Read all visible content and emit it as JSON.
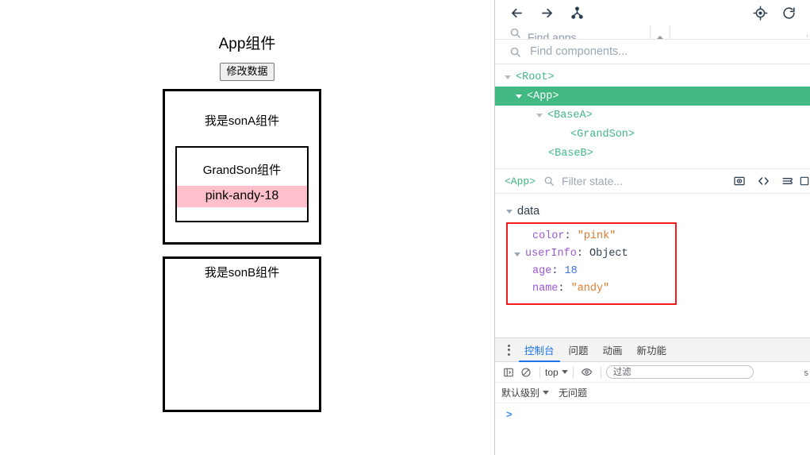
{
  "page": {
    "app_title": "App组件",
    "modify_button": "修改数据",
    "sonA": {
      "label": "我是sonA组件",
      "grandson_label": "GrandSon组件",
      "grandson_value": "pink-andy-18",
      "highlight_color": "#ffc0cb"
    },
    "sonB": {
      "label": "我是sonB组件"
    }
  },
  "devtools": {
    "toolbar": {
      "back_icon": "arrow-left-icon",
      "forward_icon": "arrow-right-icon",
      "hierarchy_icon": "component-tree-icon",
      "select_icon": "target-select-icon",
      "refresh_icon": "refresh-icon"
    },
    "find_apps": {
      "placeholder": "Find apps",
      "icon": "search-icon",
      "collapse_icon": "chevron-up-icon",
      "tail": ","
    },
    "find_components": {
      "placeholder": "Find components...",
      "value": "",
      "icon": "search-icon"
    },
    "tree": [
      {
        "label": "<Root>",
        "depth": 0,
        "expandable": true,
        "selected": false
      },
      {
        "label": "<App>",
        "depth": 1,
        "expandable": true,
        "selected": true
      },
      {
        "label": "<BaseA>",
        "depth": 2,
        "expandable": true,
        "selected": false
      },
      {
        "label": "<GrandSon>",
        "depth": 3,
        "expandable": false,
        "selected": false
      },
      {
        "label": "<BaseB>",
        "depth": 2,
        "expandable": false,
        "selected": false
      }
    ],
    "filter_bar": {
      "component_tag": "<App>",
      "search_icon": "search-icon",
      "placeholder": "Filter state...",
      "value": "",
      "icons": [
        "inspect-dom-icon",
        "open-in-editor-icon",
        "collapse-all-icon",
        "split-panel-icon"
      ]
    },
    "state": {
      "section": "data",
      "entries": [
        {
          "key": "color",
          "value": "\"pink\"",
          "type": "string",
          "indent": 1,
          "expandable": false
        },
        {
          "key": "userInfo",
          "value": "Object",
          "type": "object",
          "indent": 0,
          "expandable": true
        },
        {
          "key": "age",
          "value": "18",
          "type": "number",
          "indent": 2,
          "expandable": false
        },
        {
          "key": "name",
          "value": "\"andy\"",
          "type": "string",
          "indent": 2,
          "expandable": false
        }
      ],
      "annotation_color": "#f11b1b"
    },
    "console": {
      "tabs": [
        {
          "label": "控制台",
          "active": true
        },
        {
          "label": "问题",
          "active": false
        },
        {
          "label": "动画",
          "active": false
        },
        {
          "label": "新功能",
          "active": false
        }
      ],
      "menu_icon": "kebab-menu-icon",
      "sidebar_icon": "show-sidebar-icon",
      "clear_icon": "clear-console-icon",
      "context": "top",
      "eye_icon": "live-expression-icon",
      "filter_placeholder": "过滤",
      "filter_value": "",
      "settings_tail": "s",
      "level": "默认级别",
      "issues": "无问题",
      "prompt": ">"
    }
  }
}
